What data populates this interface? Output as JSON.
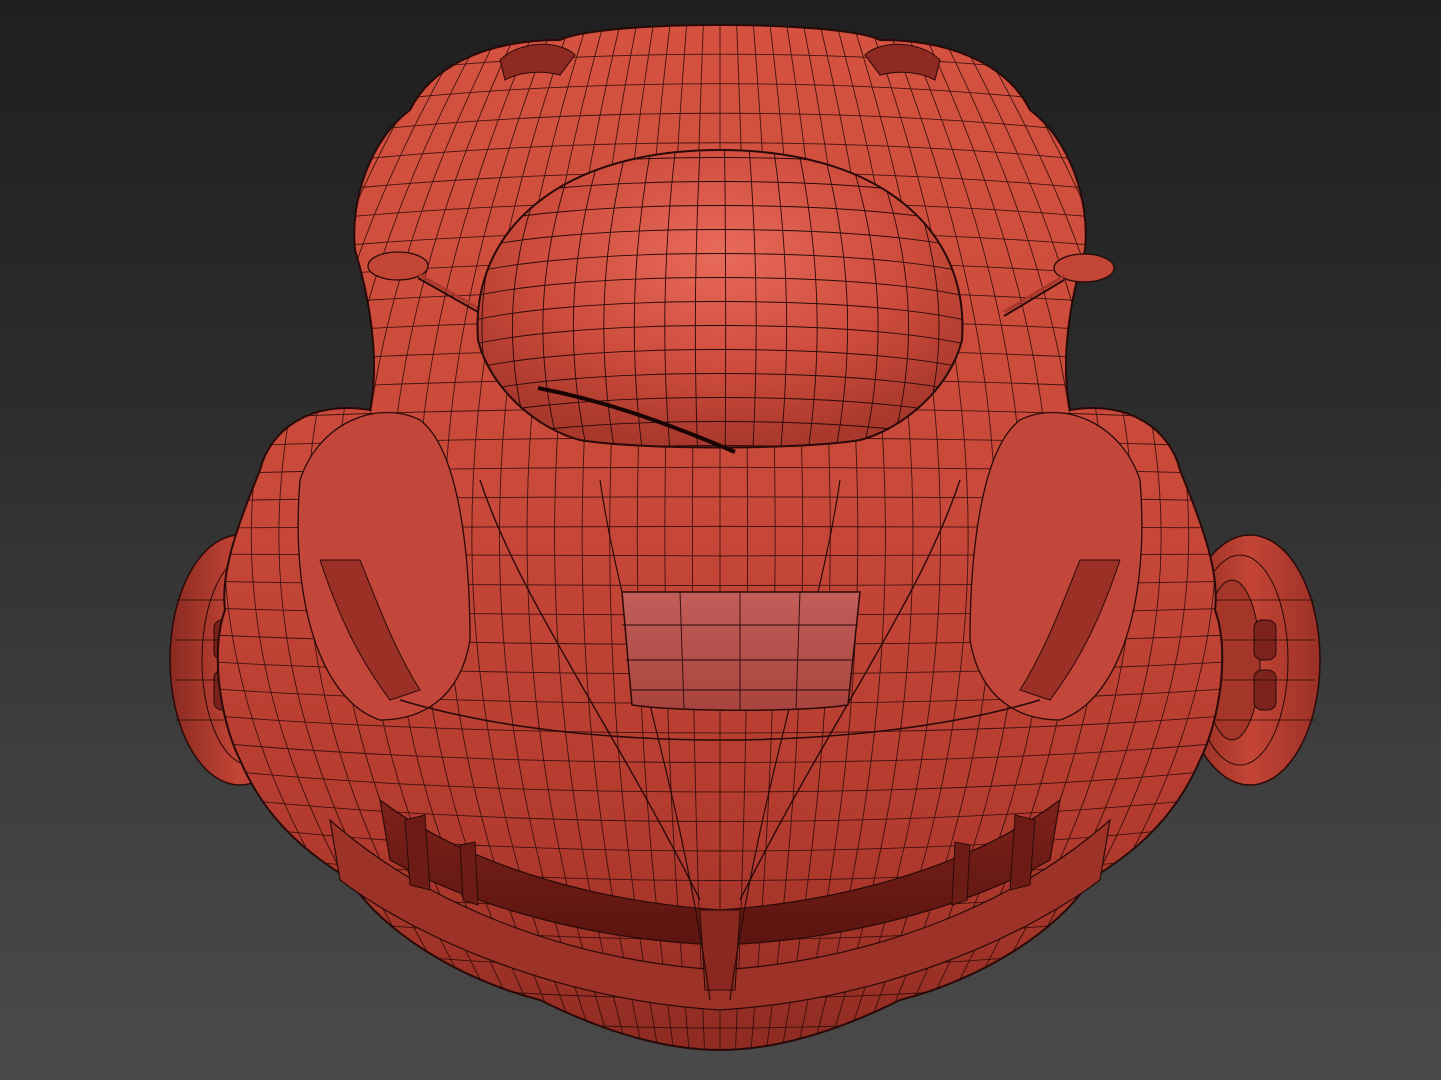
{
  "viewport": {
    "background_top": "#1f1f1f",
    "background_bottom": "#4a4a4a"
  },
  "model": {
    "shading": "wireframe-on-shaded",
    "surface_color": "#c9493a",
    "surface_highlight": "#e7685a",
    "surface_shadow": "#7a1f18",
    "wire_color": "#2a0a08"
  }
}
